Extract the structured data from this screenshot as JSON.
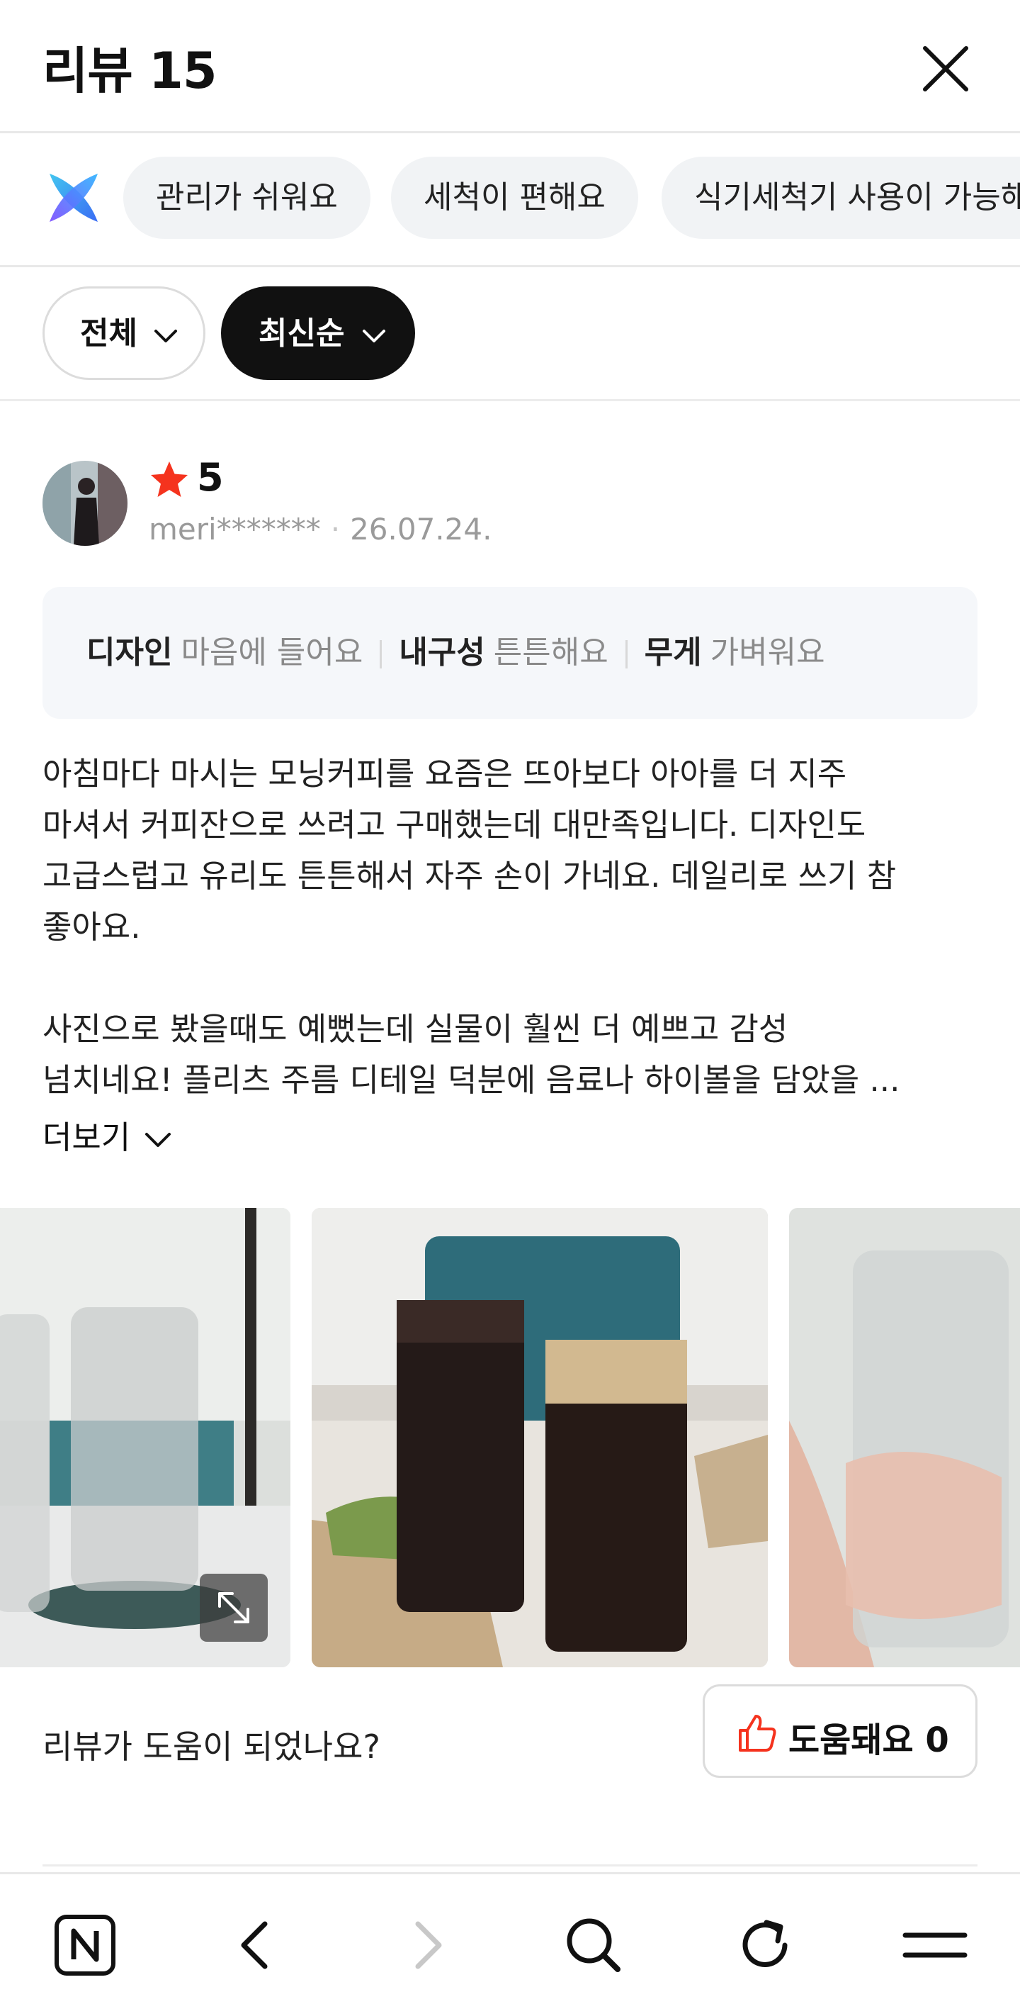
{
  "header": {
    "title": "리뷰 15"
  },
  "keywords": {
    "items": [
      "관리가 쉬워요",
      "세척이 편해요",
      "식기세척기 사용이 가능해요"
    ]
  },
  "filters": {
    "all_label": "전체",
    "sort_label": "최신순"
  },
  "review": {
    "rating": "5",
    "author": "meri*******",
    "date": "26.07.24.",
    "attributes": [
      {
        "key": "디자인",
        "value": "마음에 들어요"
      },
      {
        "key": "내구성",
        "value": "튼튼해요"
      },
      {
        "key": "무게",
        "value": "가벼워요"
      }
    ],
    "text": "아침마다 마시는 모닝커피를 요즘은 뜨아보다 아아를 더 지주\n마셔서 커피잔으로 쓰려고 구매했는데 대만족입니다. 디자인도\n고급스럽고 유리도 튼튼해서 자주 손이 가네요. 데일리로 쓰기 참\n좋아요.\n\n사진으로 봤을때도 예뻤는데 실물이 훨씬 더 예쁘고 감성\n넘치네요! 플리츠 주름 디테일 덕분에 음료나 하이볼을 담았을 ...",
    "more_label": "더보기",
    "helpful_question": "리뷰가 도움이 되었나요?",
    "helpful_label": "도움돼요",
    "helpful_count": "0"
  },
  "colors": {
    "star": "#f5331e",
    "chip_bg": "#f1f3f5",
    "attr_bg": "#f5f7fa",
    "sort_bg": "#111111",
    "thumb": "#f5331e"
  },
  "navbar": {
    "icons": [
      "naver-home-icon",
      "back-arrow-icon",
      "forward-arrow-icon",
      "search-icon",
      "refresh-icon",
      "menu-icon"
    ]
  }
}
